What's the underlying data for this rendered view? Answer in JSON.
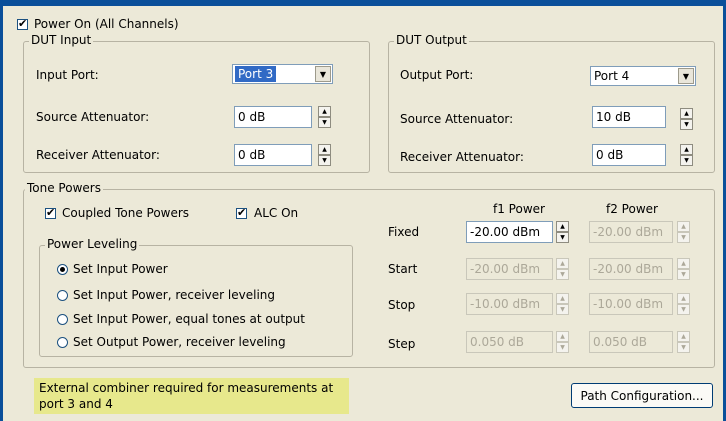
{
  "power_on": {
    "label": "Power On (All Channels)",
    "checked": true
  },
  "dut_input": {
    "legend": "DUT Input",
    "port_label": "Input Port:",
    "port_value": "Port 3",
    "src_att_label": "Source Attenuator:",
    "src_att_value": "0 dB",
    "rcv_att_label": "Receiver Attenuator:",
    "rcv_att_value": "0 dB"
  },
  "dut_output": {
    "legend": "DUT Output",
    "port_label": "Output Port:",
    "port_value": "Port 4",
    "src_att_label": "Source Attenuator:",
    "src_att_value": "10 dB",
    "rcv_att_label": "Receiver Attenuator:",
    "rcv_att_value": "0 dB"
  },
  "tone_powers": {
    "legend": "Tone Powers",
    "coupled_label": "Coupled Tone Powers",
    "alc_label": "ALC On",
    "f1_header": "f1 Power",
    "f2_header": "f2 Power",
    "rows": {
      "fixed": {
        "label": "Fixed",
        "f1": "-20.00 dBm",
        "f2": "-20.00 dBm"
      },
      "start": {
        "label": "Start",
        "f1": "-20.00 dBm",
        "f2": "-20.00 dBm"
      },
      "stop": {
        "label": "Stop",
        "f1": "-10.00 dBm",
        "f2": "-10.00 dBm"
      },
      "step": {
        "label": "Step",
        "f1": "0.050 dB",
        "f2": "0.050 dB"
      }
    },
    "leveling": {
      "legend": "Power Leveling",
      "options": [
        "Set Input Power",
        "Set Input Power, receiver leveling",
        "Set Input Power, equal tones at output",
        "Set Output Power, receiver leveling"
      ],
      "selected": 0
    }
  },
  "note": "External combiner required for measurements at port 3 and 4",
  "path_config_label": "Path Configuration...",
  "colors": {
    "window_bg": "#ece9d8",
    "frame_blue": "#0a4f9a",
    "note_bg": "#e7e88c",
    "selection": "#316ac5"
  }
}
